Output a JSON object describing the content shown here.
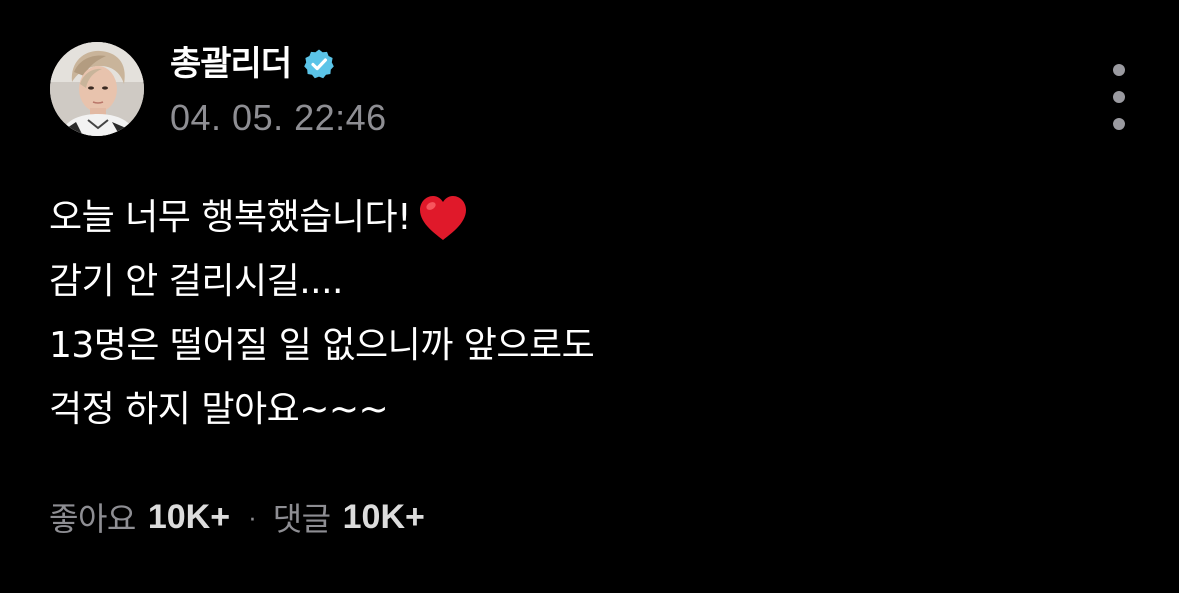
{
  "author": {
    "name": "총괄리더",
    "verified": true,
    "verified_badge_color": "#5bc4e8",
    "avatar_icon": "profile-photo"
  },
  "timestamp": "04. 05. 22:46",
  "more_icon": "vertical-ellipsis-icon",
  "post": {
    "lines": [
      "오늘 너무 행복했습니다!",
      "감기 안 걸리시길....",
      "13명은 떨어질 일 없으니까 앞으로도",
      "걱정 하지 말아요~~~"
    ],
    "emoji": "heart-icon",
    "emoji_color": "#e0192a"
  },
  "footer": {
    "likes_label": "좋아요",
    "likes_count": "10K+",
    "separator": "·",
    "comments_label": "댓글",
    "comments_count": "10K+"
  }
}
